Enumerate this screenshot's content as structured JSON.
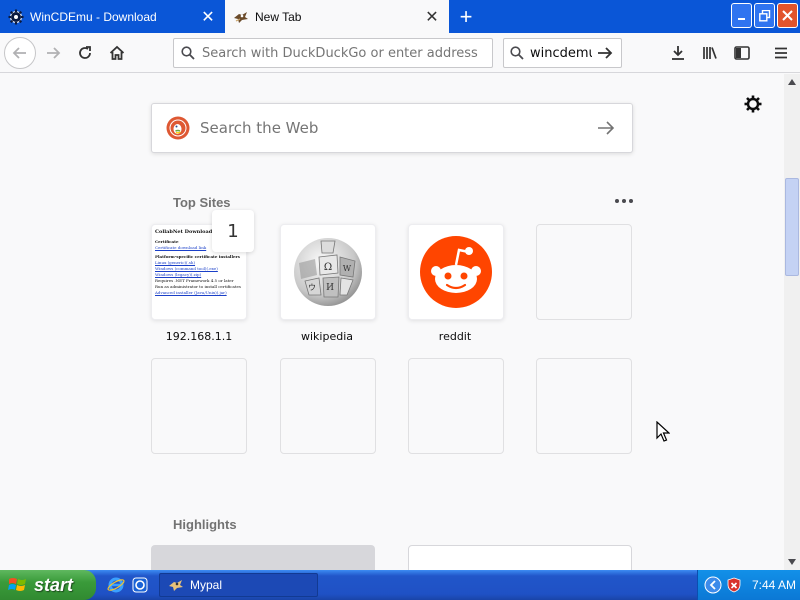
{
  "tabs": [
    {
      "title": "WinCDEmu - Download",
      "active": false
    },
    {
      "title": "New Tab",
      "active": true
    }
  ],
  "navbar": {
    "url_placeholder": "Search with DuckDuckGo or enter address",
    "search_value": "wincdemu"
  },
  "newtab": {
    "search_placeholder": "Search the Web",
    "topsites_title": "Top Sites",
    "topsites": [
      {
        "label": "192.168.1.1",
        "badge": "1"
      },
      {
        "label": "wikipedia"
      },
      {
        "label": "reddit"
      }
    ],
    "router_thumb": {
      "heading": "CollabNet Downloads",
      "section1": "Certificate",
      "link1": "Certificate download link",
      "section2": "Platform-specific certificate installers",
      "links": [
        "Linux (generic)(.sh)",
        "Windows (command tool)(.exe)",
        "Windows (legacy)(.zip)"
      ],
      "notes": [
        "Requires .NET Framework 4.5 or later",
        "Run as administrator to install certificates",
        "Advanced installer (Java/Unix)(.jar)"
      ]
    },
    "highlights_title": "Highlights"
  },
  "taskbar": {
    "start_label": "start",
    "task_label": "Mypal",
    "clock": "7:44 AM"
  },
  "colors": {
    "titlebar": "#0a56d7",
    "reddit": "#ff4500",
    "ddg": "#de5833",
    "taskbar": "#245edb",
    "start": "#3a9b3a"
  }
}
